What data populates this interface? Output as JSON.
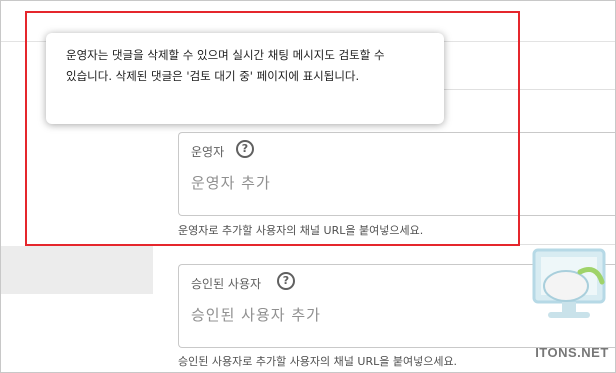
{
  "tooltip": {
    "text": "운영자는 댓글을 삭제할 수 있으며 실시간 채팅 메시지도 검토할 수 있습니다. 삭제된 댓글은 '검토 대기 중' 페이지에 표시됩니다."
  },
  "moderators": {
    "label": "운영자",
    "help_icon": "help-circle-icon",
    "placeholder": "운영자 추가",
    "hint": "운영자로 추가할 사용자의 채널 URL을 붙여넣으세요."
  },
  "approved_users": {
    "label": "승인된 사용자",
    "help_icon": "help-circle-icon",
    "placeholder": "승인된 사용자 추가",
    "hint": "승인된 사용자로 추가할 사용자의 채널 URL을 붙여넣으세요."
  },
  "watermark": {
    "text": "ITONS.NET",
    "icon": "monitor-mouse-logo"
  },
  "colors": {
    "highlight_border": "#e5262c",
    "side_band": "#ececec",
    "field_border": "#c9c9c9"
  }
}
